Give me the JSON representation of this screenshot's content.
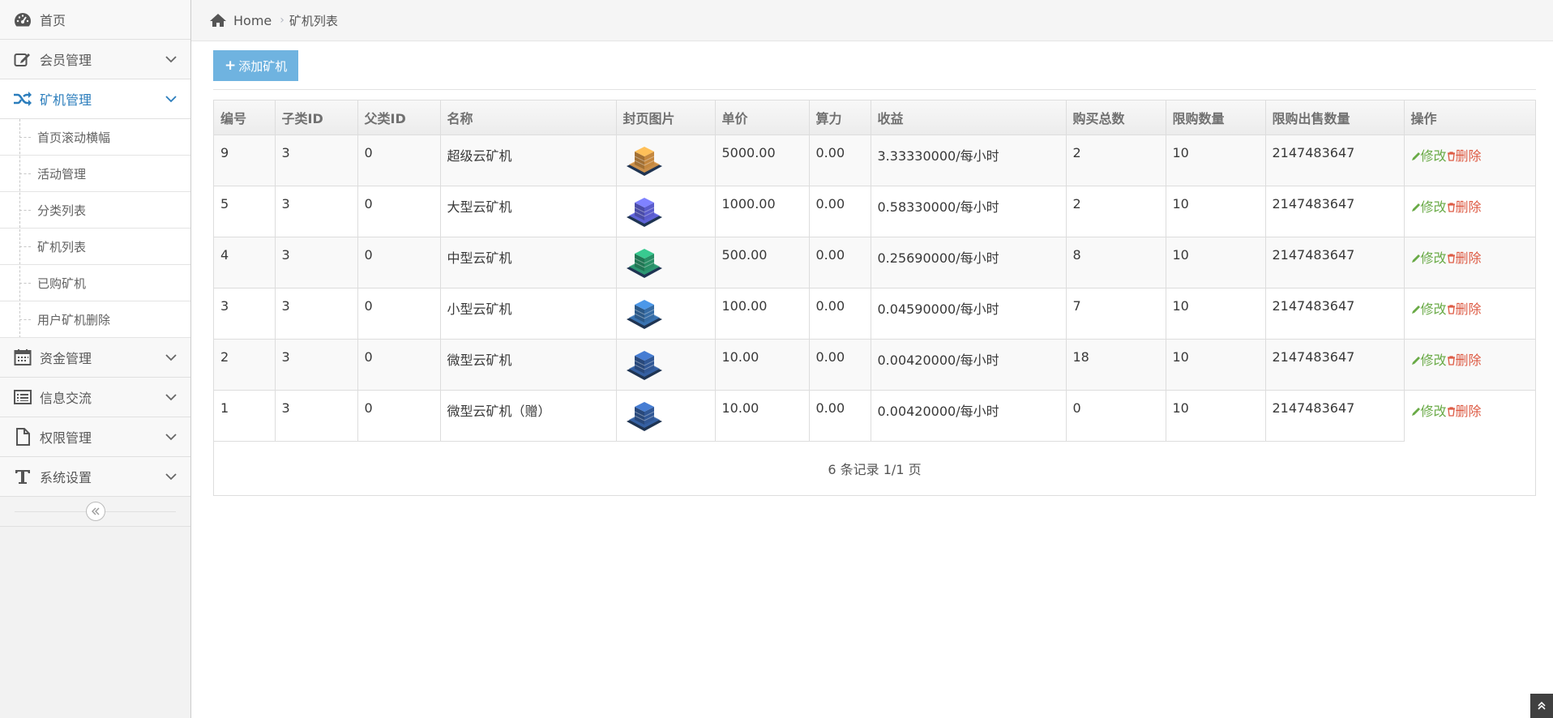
{
  "sidebar": {
    "items": [
      {
        "label": "首页",
        "icon": "dashboard-icon"
      },
      {
        "label": "会员管理",
        "icon": "edit-icon"
      },
      {
        "label": "矿机管理",
        "icon": "shuffle-icon"
      },
      {
        "label": "资金管理",
        "icon": "calendar-icon"
      },
      {
        "label": "信息交流",
        "icon": "list-icon"
      },
      {
        "label": "权限管理",
        "icon": "file-icon"
      },
      {
        "label": "系统设置",
        "icon": "text-icon"
      }
    ],
    "submenu": [
      {
        "label": "首页滚动横幅"
      },
      {
        "label": "活动管理"
      },
      {
        "label": "分类列表"
      },
      {
        "label": "矿机列表"
      },
      {
        "label": "已购矿机"
      },
      {
        "label": "用户矿机删除"
      }
    ]
  },
  "breadcrumb": {
    "home": "Home",
    "current": "矿机列表"
  },
  "toolbar": {
    "add_label": "添加矿机"
  },
  "table": {
    "headers": [
      "编号",
      "子类ID",
      "父类ID",
      "名称",
      "封页图片",
      "单价",
      "算力",
      "收益",
      "购买总数",
      "限购数量",
      "限购出售数量",
      "操作"
    ],
    "rows": [
      {
        "id": "9",
        "sub_id": "3",
        "parent_id": "0",
        "name": "超级云矿机",
        "icon_color": "#e8a04a",
        "price": "5000.00",
        "power": "0.00",
        "income": "3.33330000/每小时",
        "total": "2",
        "limit": "10",
        "limit_sale": "2147483647"
      },
      {
        "id": "5",
        "sub_id": "3",
        "parent_id": "0",
        "name": "大型云矿机",
        "icon_color": "#6a6cf0",
        "price": "1000.00",
        "power": "0.00",
        "income": "0.58330000/每小时",
        "total": "2",
        "limit": "10",
        "limit_sale": "2147483647"
      },
      {
        "id": "4",
        "sub_id": "3",
        "parent_id": "0",
        "name": "中型云矿机",
        "icon_color": "#2fa878",
        "price": "500.00",
        "power": "0.00",
        "income": "0.25690000/每小时",
        "total": "8",
        "limit": "10",
        "limit_sale": "2147483647"
      },
      {
        "id": "3",
        "sub_id": "3",
        "parent_id": "0",
        "name": "小型云矿机",
        "icon_color": "#3f7fc2",
        "price": "100.00",
        "power": "0.00",
        "income": "0.04590000/每小时",
        "total": "7",
        "limit": "10",
        "limit_sale": "2147483647"
      },
      {
        "id": "2",
        "sub_id": "3",
        "parent_id": "0",
        "name": "微型云矿机",
        "icon_color": "#3a68b0",
        "price": "10.00",
        "power": "0.00",
        "income": "0.00420000/每小时",
        "total": "18",
        "limit": "10",
        "limit_sale": "2147483647"
      },
      {
        "id": "1",
        "sub_id": "3",
        "parent_id": "0",
        "name": "微型云矿机（赠）",
        "icon_color": "#3a68b0",
        "price": "10.00",
        "power": "0.00",
        "income": "0.00420000/每小时",
        "total": "0",
        "limit": "10",
        "limit_sale": "2147483647"
      }
    ],
    "edit_label": "修改",
    "delete_label": "删除"
  },
  "pager": {
    "text": "6 条记录 1/1 页"
  }
}
